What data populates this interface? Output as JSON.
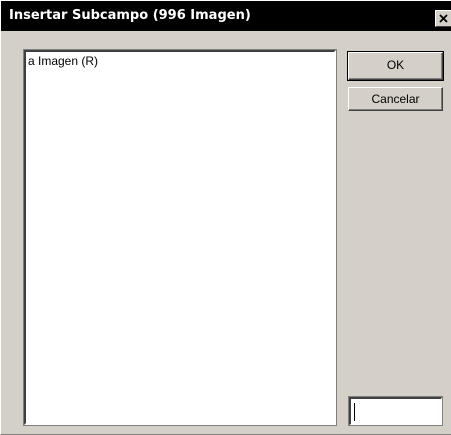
{
  "window": {
    "title": "Insertar Subcampo (996 Imagen)",
    "close_icon": "close-icon"
  },
  "list": {
    "items": [
      {
        "label": "a Imagen (R)"
      }
    ]
  },
  "buttons": {
    "ok_label": "OK",
    "cancel_label": "Cancelar"
  },
  "filter_input": {
    "value": ""
  },
  "colors": {
    "titlebar_bg": "#000000",
    "dialog_bg": "#d4d0c8",
    "list_bg": "#ffffff"
  }
}
